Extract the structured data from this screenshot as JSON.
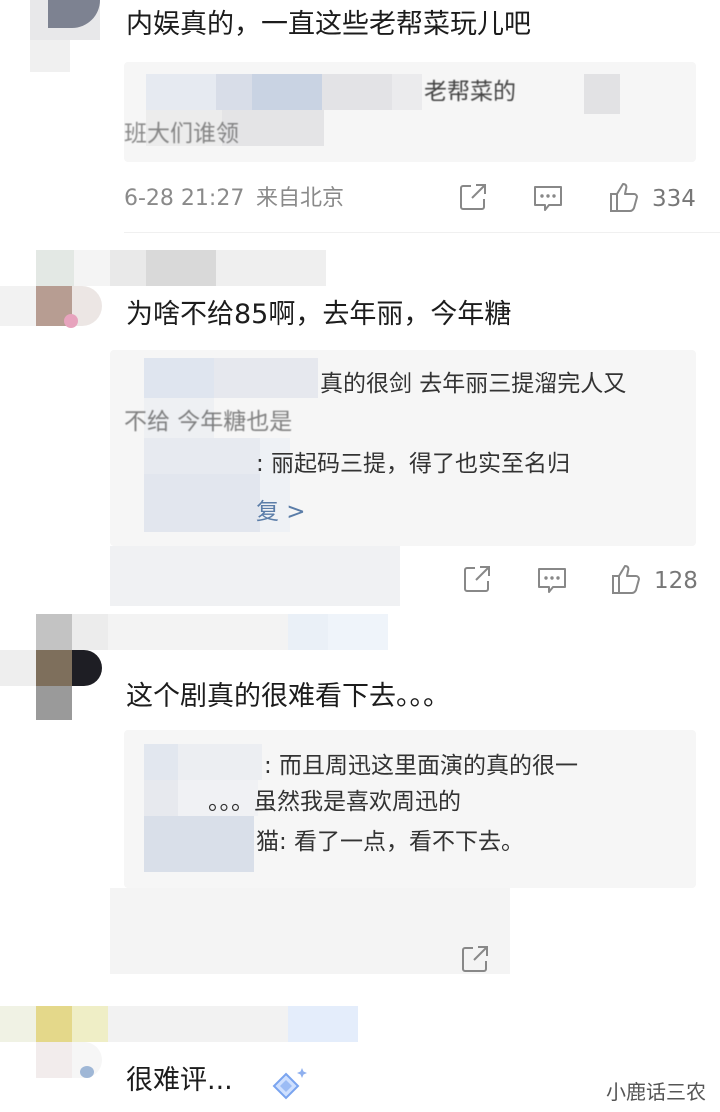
{
  "comments": [
    {
      "text": "内娱真的，一直这些老帮菜玩儿吧",
      "replies": [
        "老帮菜的",
        "班大们谁领"
      ],
      "time": "6-28 21:27",
      "location": "来自北京",
      "likes": "334"
    },
    {
      "text": "为啥不给85啊，去年丽，今年糖",
      "replies": [
        "真的很剑 去年丽三提溜完人又",
        "不给 今年糖也是",
        ": 丽起码三提，得了也实至名归"
      ],
      "more_replies": "复 >",
      "likes": "128"
    },
    {
      "text": "这个剧真的很难看下去。。。",
      "replies": [
        ": 而且周迅这里面演的真的很一",
        "。。。虽然我是喜欢周迅的",
        "猫: 看了一点，看不下去。"
      ]
    },
    {
      "text": "很难评..."
    }
  ],
  "watermark": "小鹿话三农",
  "icons": {
    "share": "share-icon",
    "comment": "comment-icon",
    "like": "thumbs-up-icon"
  }
}
